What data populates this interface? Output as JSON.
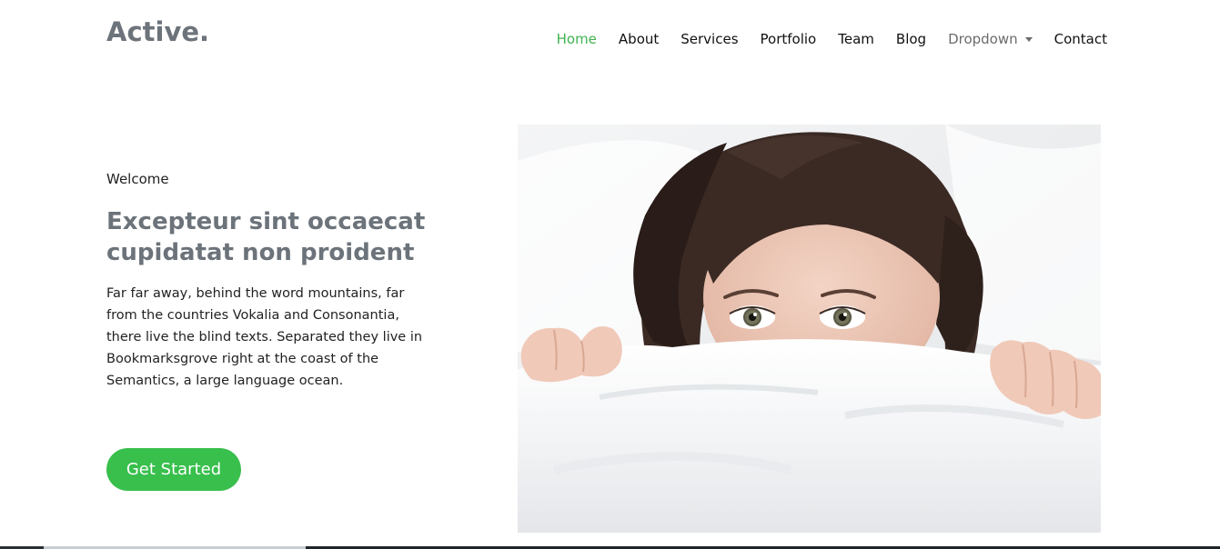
{
  "header": {
    "logo": "Active.",
    "nav": [
      {
        "label": "Home",
        "state": "active"
      },
      {
        "label": "About",
        "state": "normal"
      },
      {
        "label": "Services",
        "state": "normal"
      },
      {
        "label": "Portfolio",
        "state": "normal"
      },
      {
        "label": "Team",
        "state": "normal"
      },
      {
        "label": "Blog",
        "state": "normal"
      },
      {
        "label": "Dropdown",
        "state": "muted",
        "has_caret": true
      },
      {
        "label": "Contact",
        "state": "normal"
      }
    ]
  },
  "hero": {
    "welcome": "Welcome",
    "headline": "Excepteur sint occaecat cupidatat non proident",
    "description": "Far far away, behind the word mountains, far from the countries Vokalia and Consonantia, there live the blind texts. Separated they live in Bookmarksgrove right at the coast of the Semantics, a large language ocean.",
    "cta_label": "Get Started",
    "image_subject": "woman peeking over white blanket"
  },
  "colors": {
    "accent": "#38bf4c",
    "active_link": "#3fb34f",
    "heading": "#6c737a",
    "text": "#222222"
  }
}
